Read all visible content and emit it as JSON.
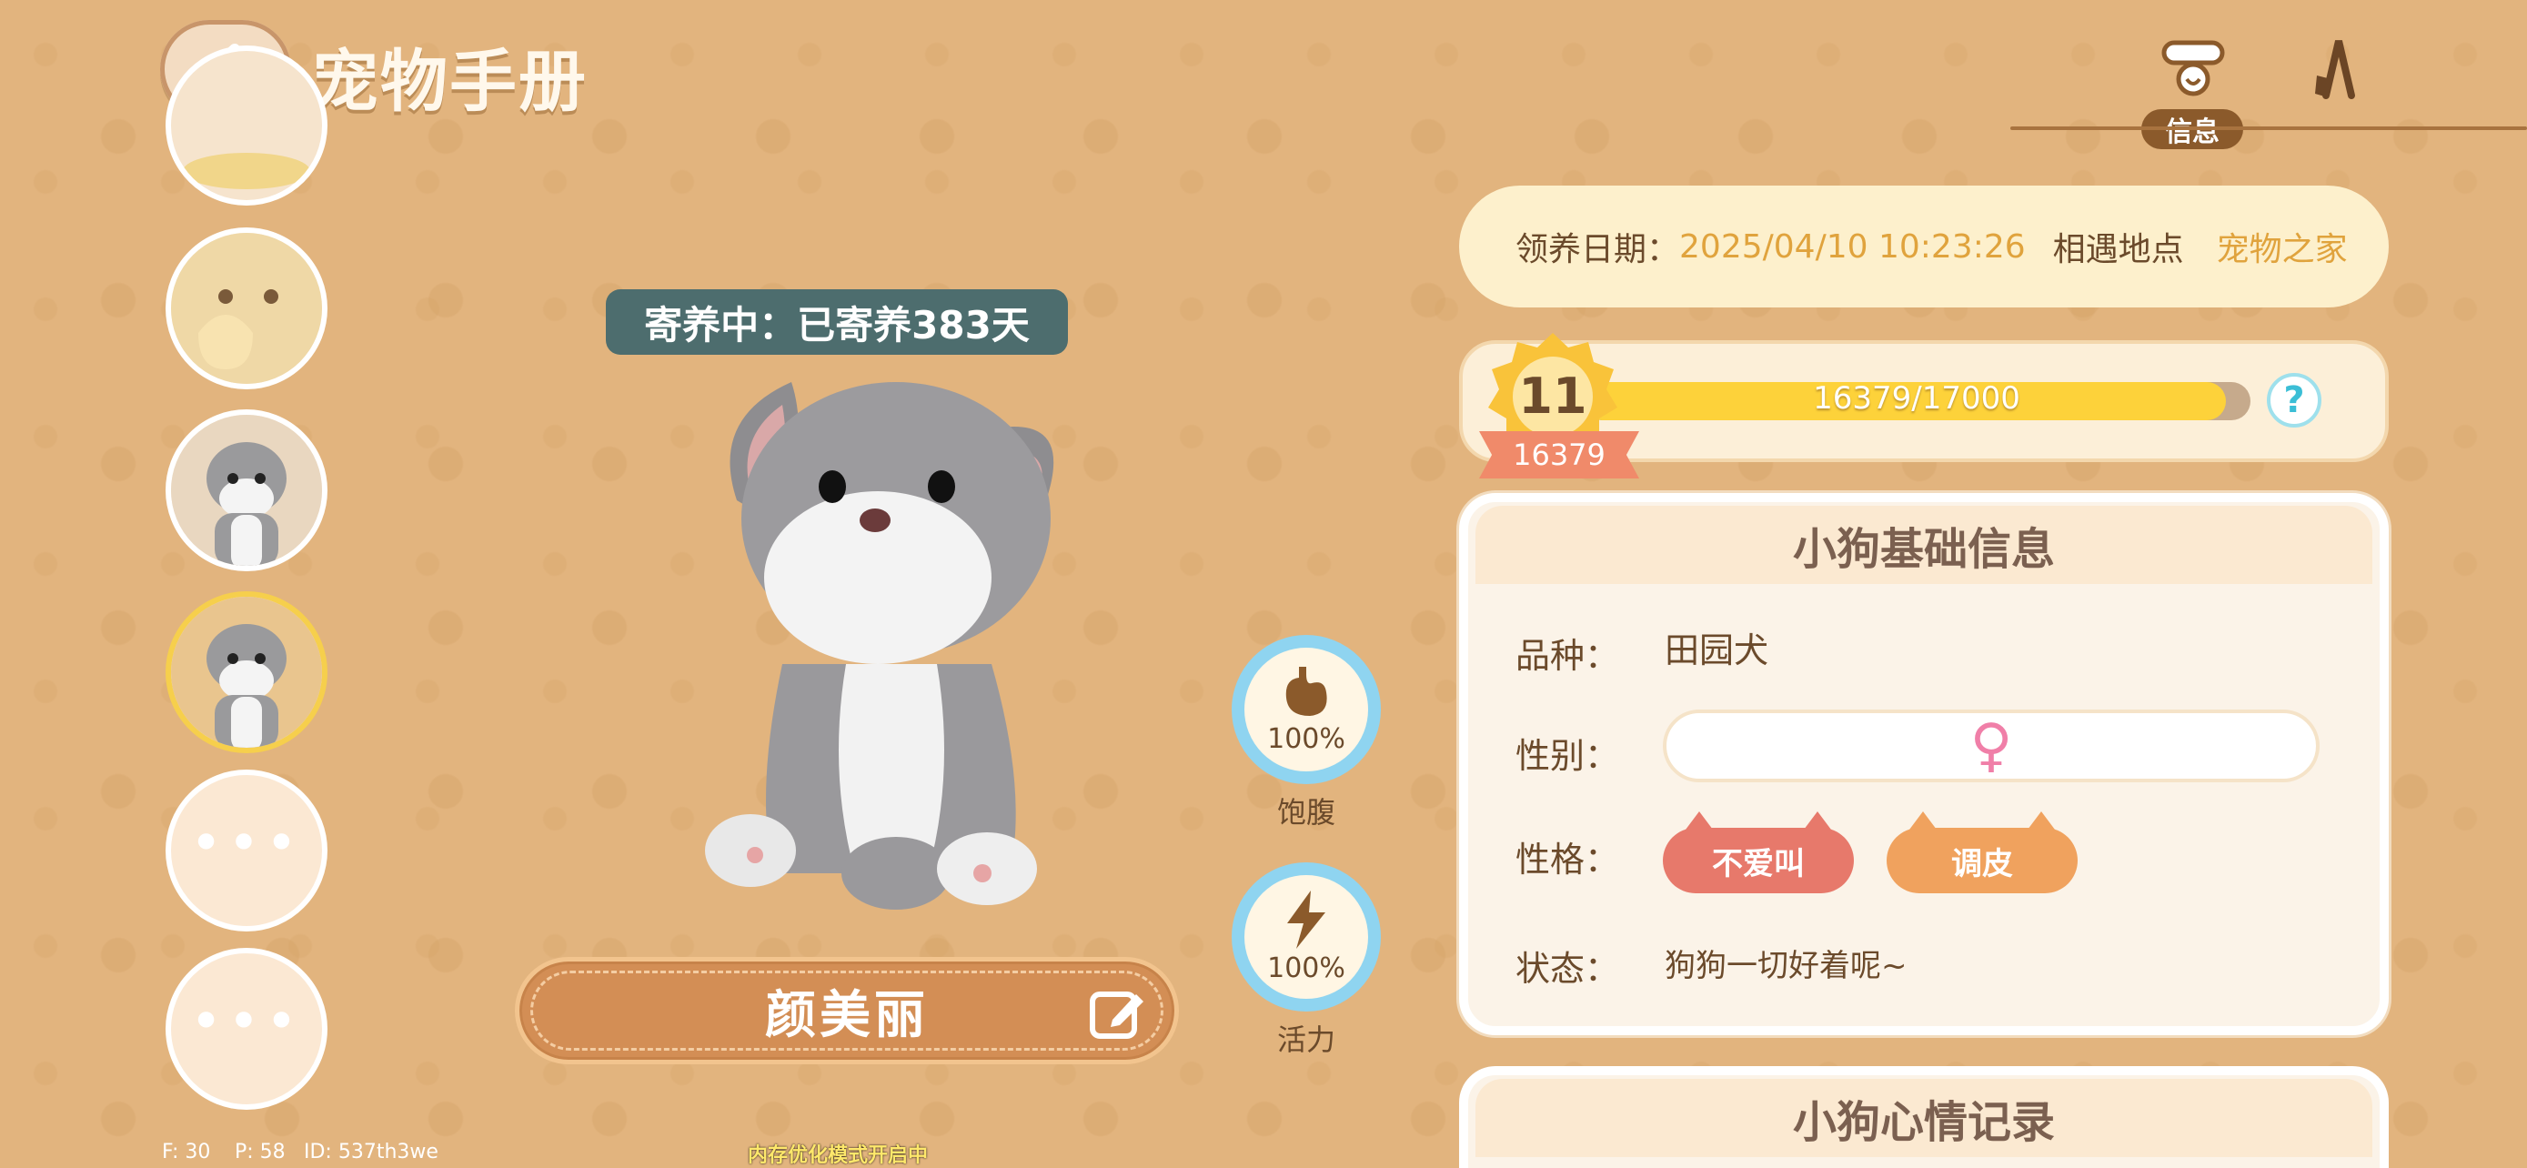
{
  "header": {
    "title": "宠物手册",
    "info_tab_label": "信息"
  },
  "pet_list": {
    "slots": [
      {
        "kind": "pet",
        "icon": "food-bowl-icon"
      },
      {
        "kind": "pet",
        "icon": "cat-toast-icon"
      },
      {
        "kind": "pet",
        "icon": "puppy-avatar-icon"
      },
      {
        "kind": "pet",
        "icon": "puppy-avatar-icon",
        "selected": true
      },
      {
        "kind": "empty",
        "label": "•••"
      },
      {
        "kind": "empty",
        "label": "•••"
      }
    ]
  },
  "pet": {
    "foster_status": "寄养中：已寄养383天",
    "name": "颜美丽"
  },
  "stats": {
    "satiety": {
      "percent": "100%",
      "label": "饱腹",
      "value": 1.0
    },
    "energy": {
      "percent": "100%",
      "label": "活力",
      "value": 1.0
    }
  },
  "adoption": {
    "date_label": "领养日期：",
    "date_value": "2025/04/10 10:23:26",
    "place_label": "相遇地点",
    "place_value": "宠物之家"
  },
  "level": {
    "level": "11",
    "points": "16379",
    "xp_text": "16379/17000",
    "xp_current": 16379,
    "xp_max": 17000,
    "help": "?"
  },
  "basic_info": {
    "title": "小狗基础信息",
    "breed_label": "品种：",
    "breed_value": "田园犬",
    "gender_label": "性别：",
    "gender_symbol": "♀",
    "personality_label": "性格：",
    "traits": [
      "不爱叫",
      "调皮"
    ],
    "status_label": "状态：",
    "status_value": "狗狗一切好着呢~"
  },
  "mood": {
    "title": "小狗心情记录"
  },
  "debug": {
    "fps": "F: 30",
    "ping": "P: 58",
    "id": "ID: 537th3we",
    "memory_mode": "内存优化模式开启中"
  },
  "colors": {
    "background": "#e2b47e",
    "accent_yellow": "#fdd23a",
    "ring_blue": "#8fd4f0",
    "trait_red": "#e7796b",
    "trait_orange": "#f0a25e",
    "gender_pink": "#f07fa8"
  }
}
